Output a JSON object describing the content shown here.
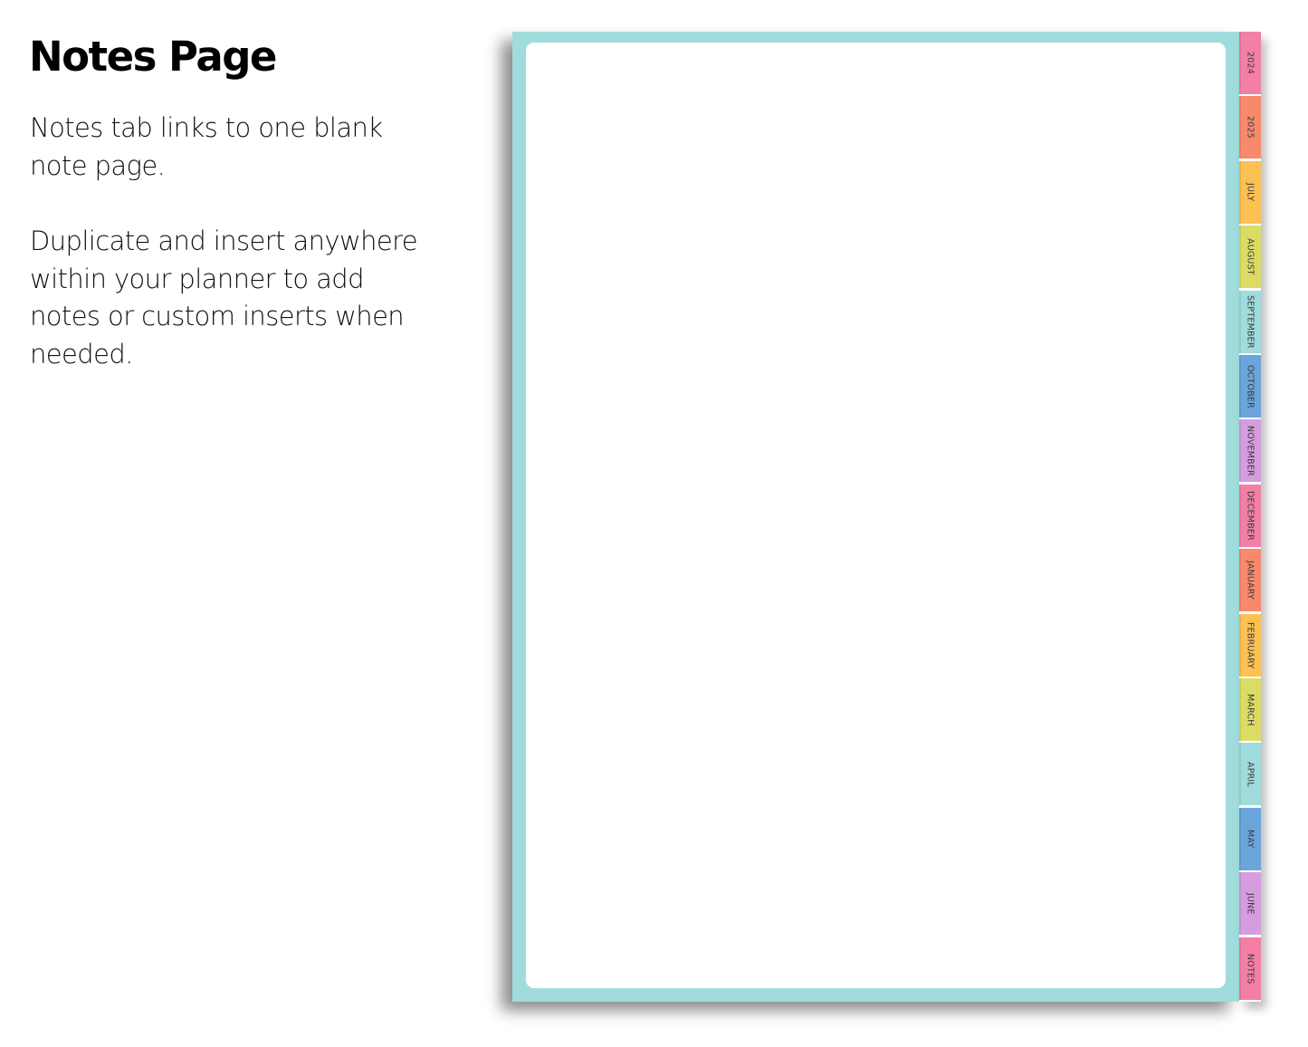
{
  "header": {
    "title": "Notes Page"
  },
  "description": {
    "paragraph1": "Notes tab links to one blank note page.",
    "paragraph2": "Duplicate and insert anywhere within your planner to add notes or custom inserts when needed."
  },
  "planner": {
    "border_color": "#a0dcdc",
    "page_color": "#ffffff",
    "tabs": [
      {
        "label": "2024",
        "color": "#f47fa5"
      },
      {
        "label": "2025",
        "color": "#f88a6b"
      },
      {
        "label": "JULY",
        "color": "#fbc152"
      },
      {
        "label": "AUGUST",
        "color": "#dcdc64"
      },
      {
        "label": "SEPTEMBER",
        "color": "#a0dcdc"
      },
      {
        "label": "OCTOBER",
        "color": "#6aa5dc"
      },
      {
        "label": "NOVEMBER",
        "color": "#d79ce0"
      },
      {
        "label": "DECEMBER",
        "color": "#f47fa5"
      },
      {
        "label": "JANUARY",
        "color": "#f88a6b"
      },
      {
        "label": "FEBRUARY",
        "color": "#fbc152"
      },
      {
        "label": "MARCH",
        "color": "#dcdc64"
      },
      {
        "label": "APRIL",
        "color": "#a0dcdc"
      },
      {
        "label": "MAY",
        "color": "#6aa5dc"
      },
      {
        "label": "JUNE",
        "color": "#d79ce0"
      },
      {
        "label": "NOTES",
        "color": "#f47fa5"
      }
    ]
  }
}
